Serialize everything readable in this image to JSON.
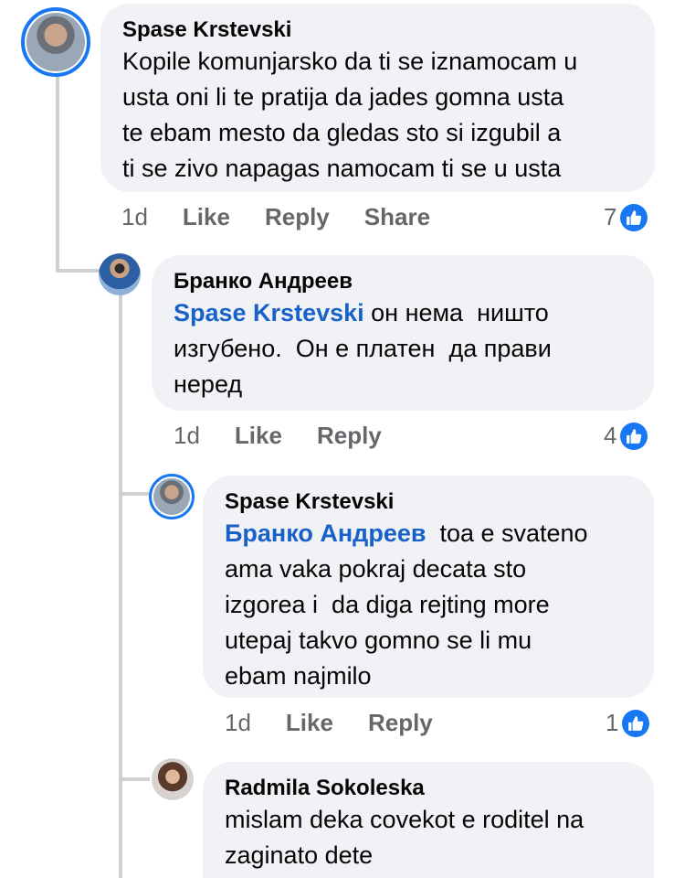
{
  "comments": [
    {
      "author": "Spase Krstevski",
      "mention": "",
      "text": "Kopile komunjarsko da ti se iznamocam u\nusta oni li te pratija da jades gomna usta\nte ebam mesto da gledas sto si izgubil a\nti se zivo napagas namocam ti se u usta",
      "time": "1d",
      "actions": [
        "Like",
        "Reply",
        "Share"
      ],
      "reactions": "7"
    },
    {
      "author": "Бранко Андреев",
      "mention": "Spase Krstevski",
      "text": " он нема  ништо\nизгубено.  Он е платен  да прави\nнеред",
      "time": "1d",
      "actions": [
        "Like",
        "Reply"
      ],
      "reactions": "4"
    },
    {
      "author": "Spase Krstevski",
      "mention": "Бранко Андреев",
      "text": "  toa e svateno\nama vaka pokraj decata sto\nizgorea i  da diga rejting more\nutepaj takvo gomno se li mu\nebam najmilo",
      "time": "1d",
      "actions": [
        "Like",
        "Reply"
      ],
      "reactions": "1"
    },
    {
      "author": "Radmila Sokoleska",
      "mention": "",
      "text": "mislam deka covekot e roditel na\nzaginato dete"
    }
  ],
  "colors": {
    "bubble": "#f0f2f5",
    "mention": "#1761c9",
    "like_blue": "#1877f2",
    "meta": "#65676b"
  },
  "icons": [
    "like-thumb-icon"
  ]
}
